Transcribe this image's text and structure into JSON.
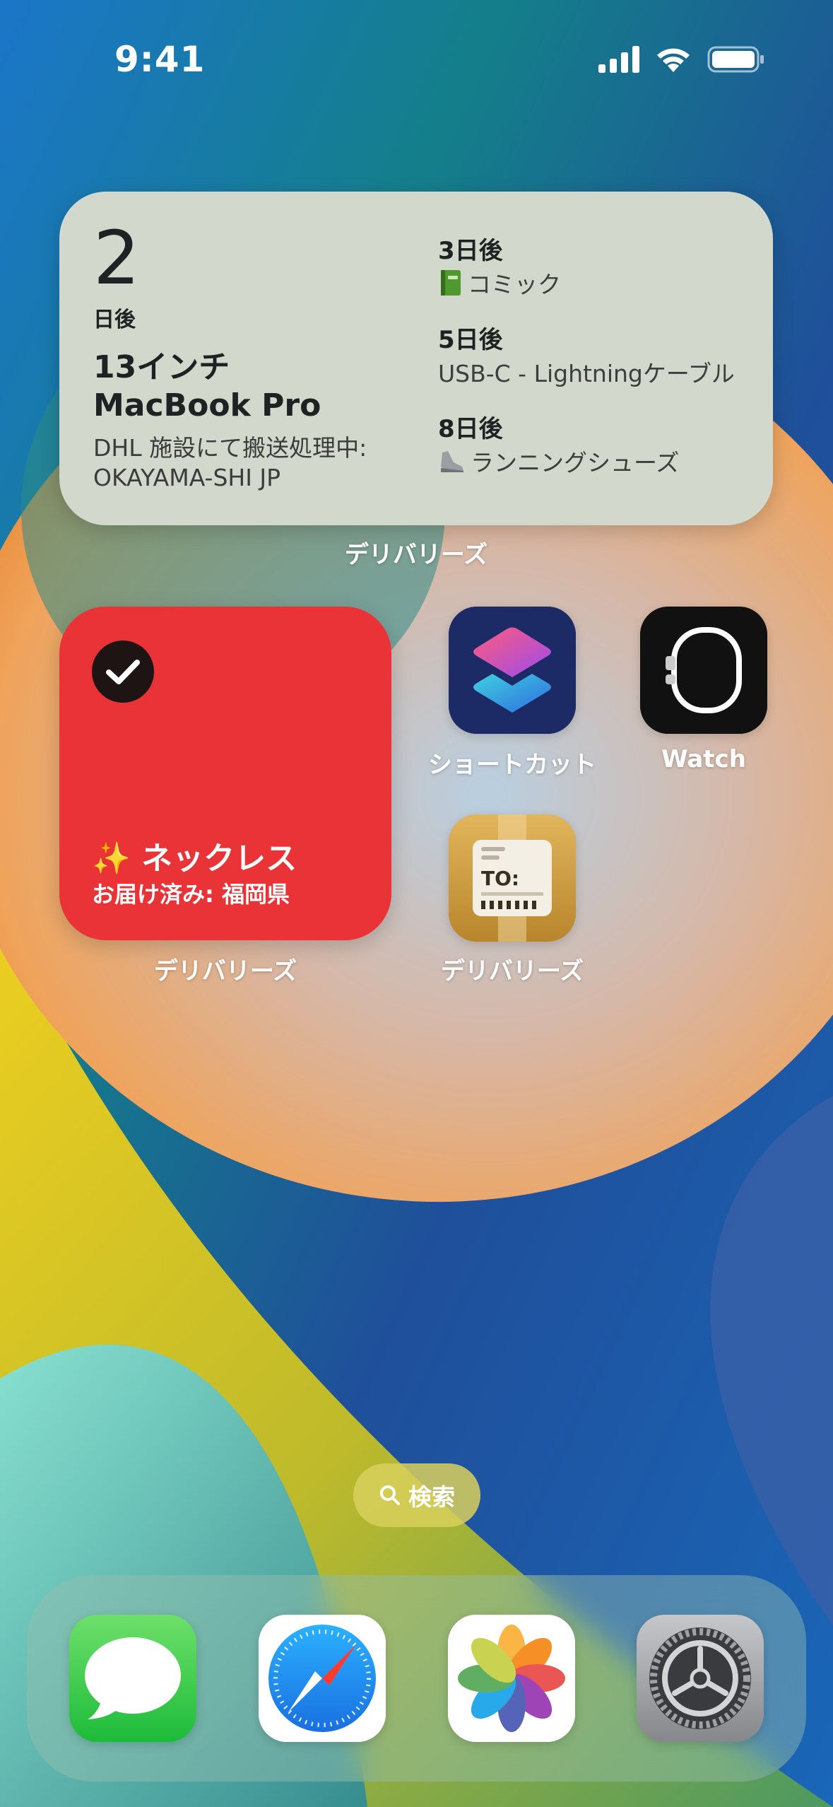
{
  "status_bar": {
    "time": "9:41"
  },
  "large_widget": {
    "days": "2",
    "days_unit": "日後",
    "package_name": "13インチ MacBook Pro",
    "package_status": "DHL 施設にて搬送処理中: OKAYAMA-SHI JP",
    "upcoming": [
      {
        "when": "3日後",
        "emoji": "book",
        "name": "コミック"
      },
      {
        "when": "5日後",
        "emoji": "",
        "name": "USB-C - Lightningケーブル"
      },
      {
        "when": "8日後",
        "emoji": "shoe",
        "name": "ランニングシューズ"
      }
    ],
    "caption": "デリバリーズ"
  },
  "small_widget": {
    "title": "✨ ネックレス",
    "subtitle": "お届け済み: 福岡県",
    "caption": "デリバリーズ",
    "color": "#ea3337"
  },
  "apps": {
    "shortcuts": {
      "label": "ショートカット"
    },
    "watch": {
      "label": "Watch"
    },
    "deliveries": {
      "label": "デリバリーズ"
    }
  },
  "search": {
    "label": "検索"
  },
  "dock": {
    "apps": [
      "messages-icon",
      "safari-icon",
      "photos-icon",
      "settings-icon"
    ]
  }
}
